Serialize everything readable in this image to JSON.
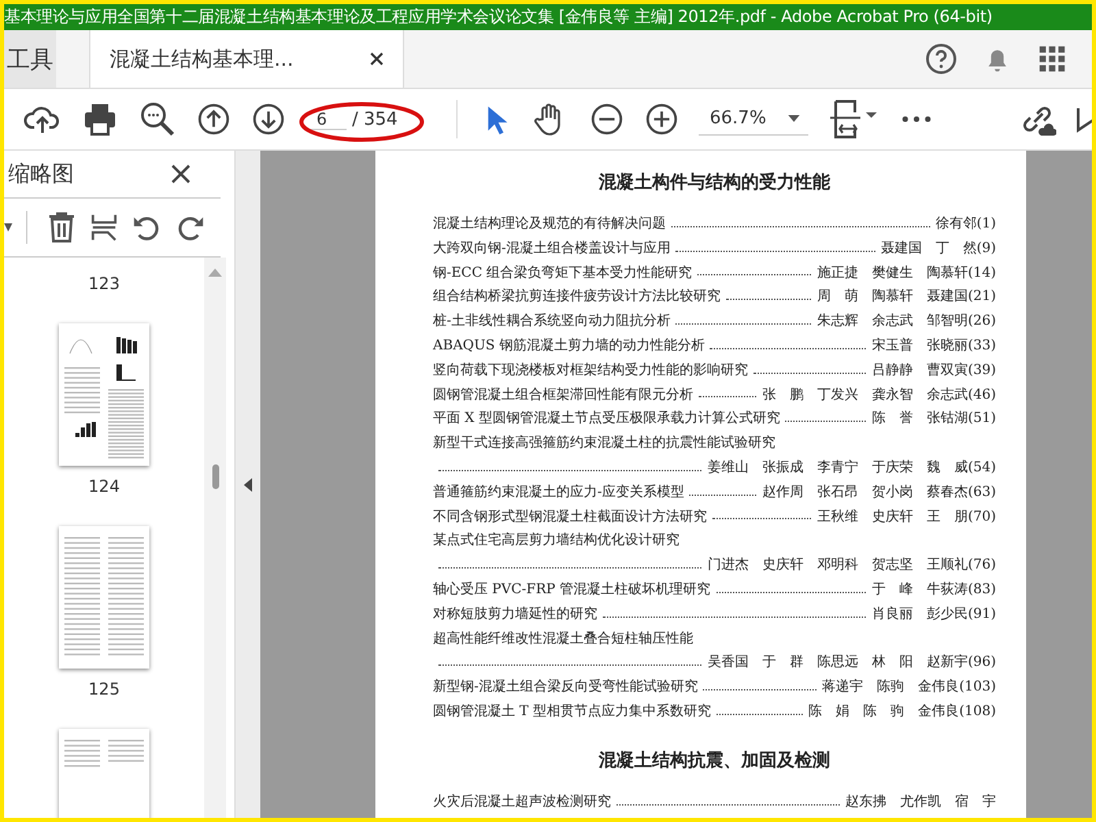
{
  "window": {
    "title": "基本理论与应用全国第十二届混凝土结构基本理论及工程应用学术会议论文集 [金伟良等 主编] 2012年.pdf - Adobe Acrobat Pro (64-bit)"
  },
  "tabs": [
    {
      "label": "工具",
      "selected": false
    },
    {
      "label": "混凝土结构基本理...",
      "selected": true
    }
  ],
  "toolbar": {
    "page_field": {
      "value": "6"
    },
    "page_total": "/ 354",
    "zoom": "66.7%"
  },
  "sidebar": {
    "title": "缩略图",
    "pages": [
      {
        "label": "123",
        "kind": "none"
      },
      {
        "label": "124",
        "kind": "charts"
      },
      {
        "label": "125",
        "kind": "text"
      },
      {
        "kind": "short"
      }
    ]
  },
  "document": {
    "sections": [
      {
        "heading": "混凝土构件与结构的受力性能",
        "entries": [
          {
            "title": "混凝土结构理论及规范的有待解决问题",
            "authors": "徐有邻(1)",
            "kind": "single"
          },
          {
            "title": "大跨双向钢-混凝土组合楼盖设计与应用",
            "authors": "聂建国　丁　然(9)",
            "kind": "single"
          },
          {
            "title": "钢-ECC 组合梁负弯矩下基本受力性能研究",
            "authors": "施正捷　樊健生　陶慕轩(14)",
            "kind": "single"
          },
          {
            "title": "组合结构桥梁抗剪连接件疲劳设计方法比较研究",
            "authors": "周　萌　陶慕轩　聂建国(21)",
            "kind": "single"
          },
          {
            "title": "桩-土非线性耦合系统竖向动力阻抗分析",
            "authors": "朱志辉　余志武　邹智明(26)",
            "kind": "single"
          },
          {
            "title": "ABAQUS 钢筋混凝土剪力墙的动力性能分析",
            "authors": "宋玉普　张晓丽(33)",
            "kind": "single"
          },
          {
            "title": "竖向荷载下现浇楼板对框架结构受力性能的影响研究",
            "authors": "吕静静　曹双寅(39)",
            "kind": "single"
          },
          {
            "title": "圆钢管混凝土组合框架滞回性能有限元分析",
            "authors": "张　鹏　丁发兴　龚永智　余志武(46)",
            "kind": "single"
          },
          {
            "title": "平面 X 型圆钢管混凝土节点受压极限承载力计算公式研究",
            "authors": "陈　誉　张钴湖(51)",
            "kind": "single"
          },
          {
            "title": "新型干式连接高强箍筋约束混凝土柱的抗震性能试验研究",
            "authors": "姜维山　张振成　李青宁　于庆荣　魏　威(54)",
            "kind": "wrapped"
          },
          {
            "title": "普通箍筋约束混凝土的应力-应变关系模型",
            "authors": "赵作周　张石昂　贺小岗　蔡春杰(63)",
            "kind": "single"
          },
          {
            "title": "不同含钢形式型钢混凝土柱截面设计方法研究",
            "authors": "王秋维　史庆轩　王　朋(70)",
            "kind": "single"
          },
          {
            "title": "某点式住宅高层剪力墙结构优化设计研究",
            "authors": "门进杰　史庆轩　邓明科　贺志坚　王顺礼(76)",
            "kind": "wrapped"
          },
          {
            "title": "轴心受压 PVC-FRP 管混凝土柱破坏机理研究",
            "authors": "于　峰　牛荻涛(83)",
            "kind": "single"
          },
          {
            "title": "对称短肢剪力墙延性的研究",
            "authors": "肖良丽　彭少民(91)",
            "kind": "single"
          },
          {
            "title": "超高性能纤维改性混凝土叠合短柱轴压性能",
            "authors": "吴香国　于　群　陈思远　林　阳　赵新宇(96)",
            "kind": "wrapped"
          },
          {
            "title": "新型钢-混凝土组合梁反向受弯性能试验研究",
            "authors": "蒋递宇　陈驹　金伟良(103)",
            "kind": "single"
          },
          {
            "title": "圆钢管混凝土 T 型相贯节点应力集中系数研究",
            "authors": "陈　娟　陈　驹　金伟良(108)",
            "kind": "single"
          }
        ]
      },
      {
        "heading": "混凝土结构抗震、加固及检测",
        "entries": [
          {
            "title": "火灾后混凝土超声波检测研究",
            "authors": "赵东拂　尤作凯　宿　宇",
            "kind": "single"
          }
        ]
      }
    ]
  }
}
